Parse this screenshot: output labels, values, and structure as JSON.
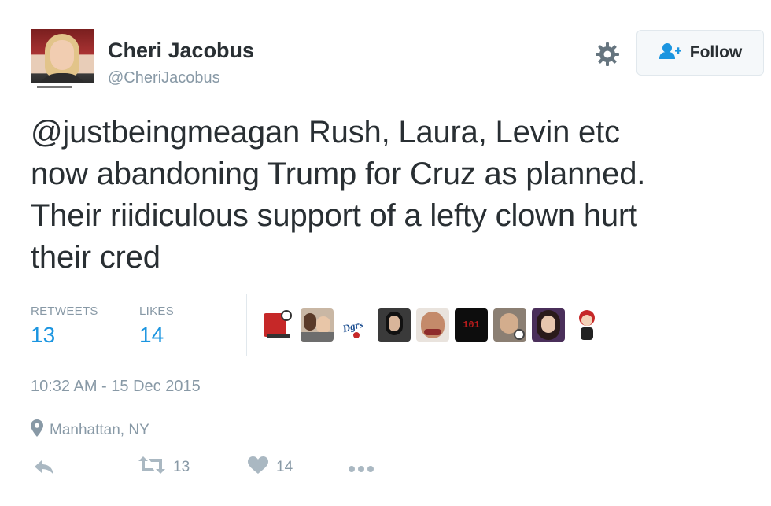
{
  "author": {
    "name": "Cheri Jacobus",
    "handle": "@CheriJacobus"
  },
  "follow_button": {
    "label": "Follow",
    "icon": "add-user-icon"
  },
  "settings_icon": "gear-icon",
  "tweet": {
    "lines": [
      "@justbeingmeagan Rush, Laura, Levin etc",
      "now abandoning Trump for Cruz as planned.",
      "Their riidiculous support of a lefty clown hurt",
      "their cred"
    ]
  },
  "stats": {
    "retweets_label": "RETWEETS",
    "retweets_value": "13",
    "likes_label": "LIKES",
    "likes_value": "14"
  },
  "timestamp": "10:32 AM - 15 Dec 2015",
  "location": {
    "icon": "map-pin-icon",
    "text": "Manhattan, NY"
  },
  "actions": {
    "reply_icon": "reply-icon",
    "retweet_icon": "retweet-icon",
    "retweet_count": "13",
    "like_icon": "heart-icon",
    "like_count": "14",
    "more_icon": "more-icon"
  },
  "colors": {
    "link_blue": "#1b95e0",
    "text": "#292f33",
    "muted": "#8899a6",
    "border": "#e1e8ed"
  }
}
